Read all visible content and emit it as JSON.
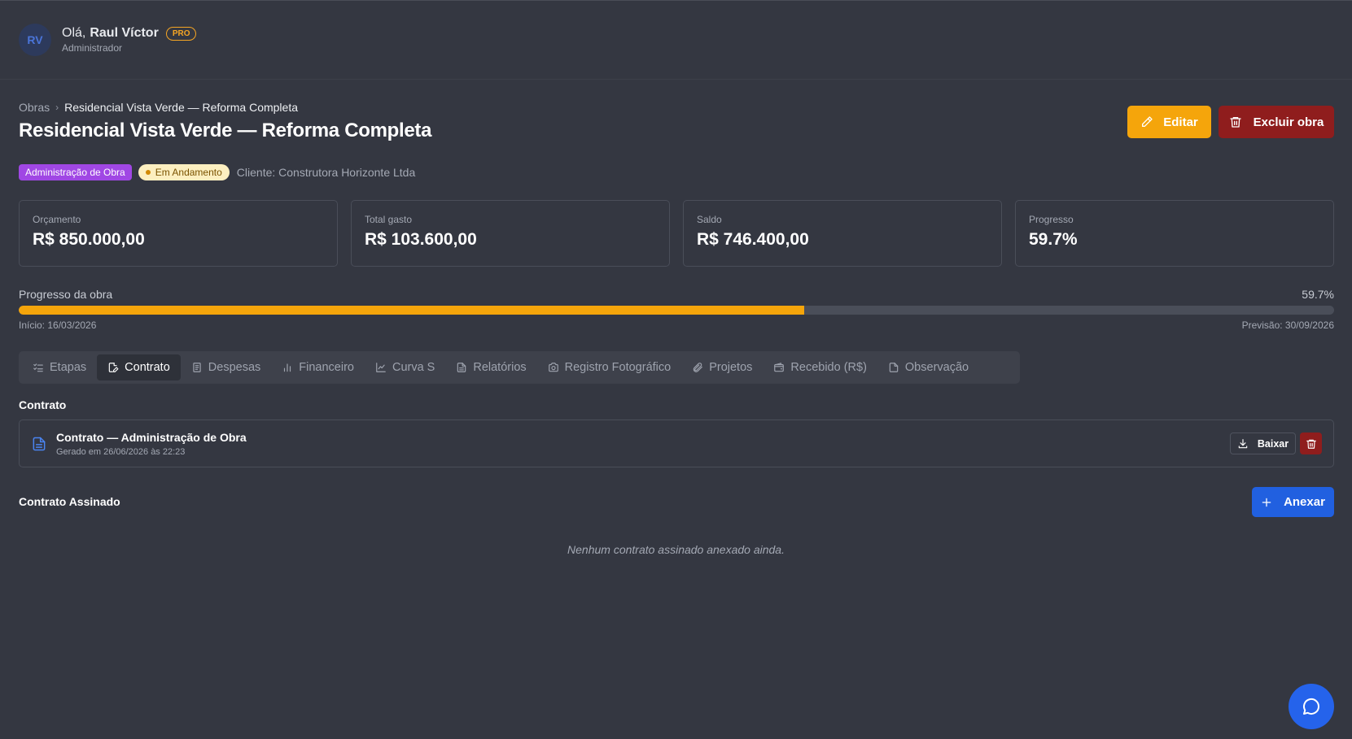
{
  "user": {
    "initials": "RV",
    "greeting": "Olá,",
    "name": "Raul Víctor",
    "plan_badge": "PRO",
    "role": "Administrador"
  },
  "breadcrumb": {
    "root": "Obras",
    "current": "Residencial Vista Verde — Reforma Completa"
  },
  "page_title": "Residencial Vista Verde — Reforma Completa",
  "actions": {
    "edit": "Editar",
    "delete": "Excluir obra"
  },
  "tags": {
    "type": "Administração de Obra",
    "status": "Em Andamento",
    "client": "Cliente: Construtora Horizonte Ltda"
  },
  "cards": [
    {
      "label": "Orçamento",
      "value": "R$ 850.000,00"
    },
    {
      "label": "Total gasto",
      "value": "R$ 103.600,00"
    },
    {
      "label": "Saldo",
      "value": "R$ 746.400,00"
    },
    {
      "label": "Progresso",
      "value": "59.7%"
    }
  ],
  "progress": {
    "label": "Progresso da obra",
    "percent_text": "59.7%",
    "percent": 59.7,
    "start": "Início: 16/03/2026",
    "end": "Previsão: 30/09/2026"
  },
  "tabs": [
    {
      "label": "Etapas",
      "icon": "list-checks-icon"
    },
    {
      "label": "Contrato",
      "icon": "file-edit-icon",
      "active": true
    },
    {
      "label": "Despesas",
      "icon": "receipt-icon"
    },
    {
      "label": "Financeiro",
      "icon": "bar-chart-icon"
    },
    {
      "label": "Curva S",
      "icon": "line-chart-icon"
    },
    {
      "label": "Relatórios",
      "icon": "file-text-icon"
    },
    {
      "label": "Registro Fotográfico",
      "icon": "camera-icon"
    },
    {
      "label": "Projetos",
      "icon": "paperclip-icon"
    },
    {
      "label": "Recebido (R$)",
      "icon": "wallet-icon"
    },
    {
      "label": "Observação",
      "icon": "file-icon"
    }
  ],
  "contract_section": {
    "title": "Contrato",
    "item": {
      "title": "Contrato — Administração de Obra",
      "generated": "Gerado em 26/06/2026 às 22:23",
      "download": "Baixar"
    }
  },
  "signed_section": {
    "title": "Contrato Assinado",
    "attach": "Anexar",
    "empty": "Nenhum contrato assinado anexado ainda."
  },
  "colors": {
    "background": "#343741",
    "accent_orange": "#f5a50b",
    "danger": "#8f1d1d",
    "primary": "#2160e0",
    "tag_purple": "#a047e4"
  }
}
